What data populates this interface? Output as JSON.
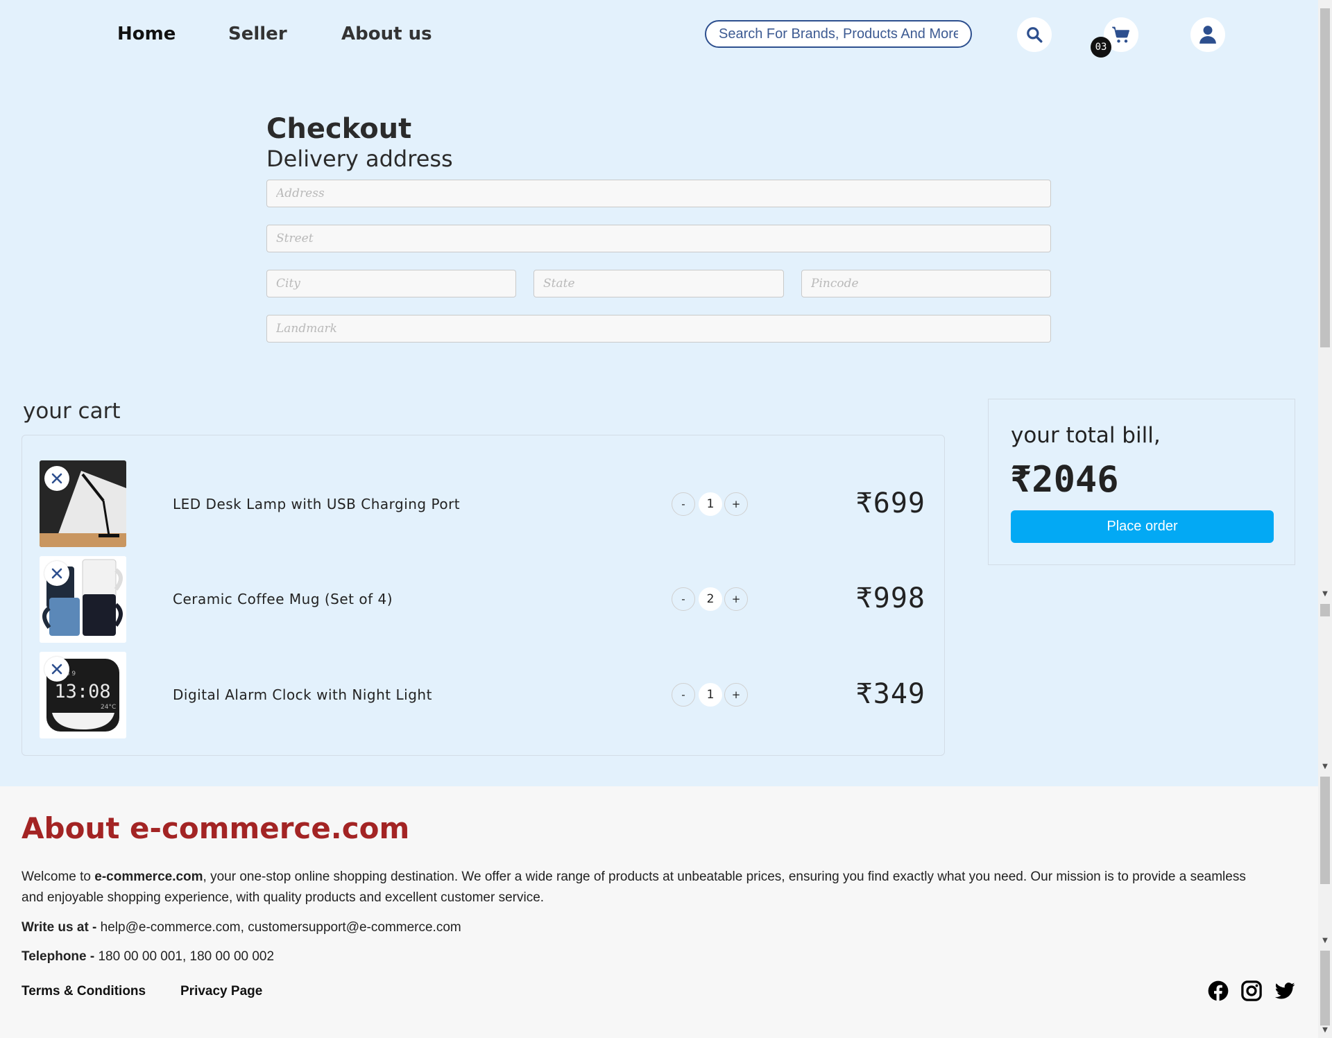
{
  "nav": {
    "links": [
      "Home",
      "Seller",
      "About us"
    ],
    "search_placeholder": "Search For Brands, Products And More",
    "cart_count": "03"
  },
  "checkout": {
    "title": "Checkout",
    "subtitle": "Delivery address",
    "fields": {
      "address": "Address",
      "street": "Street",
      "city": "City",
      "state": "State",
      "pincode": "Pincode",
      "landmark": "Landmark"
    }
  },
  "cart": {
    "title": "your cart",
    "items": [
      {
        "name": "LED Desk Lamp with USB Charging Port",
        "qty": "1",
        "price": "₹699"
      },
      {
        "name": "Ceramic Coffee Mug (Set of 4)",
        "qty": "2",
        "price": "₹998"
      },
      {
        "name": "Digital Alarm Clock with Night Light",
        "qty": "1",
        "price": "₹349"
      }
    ],
    "minus_label": "-",
    "plus_label": "+"
  },
  "bill": {
    "label": "your total bill,",
    "amount": "₹2046",
    "button": "Place order"
  },
  "footer": {
    "title": "About e-commerce.com",
    "intro_before": "Welcome to ",
    "intro_brand": "e-commerce.com",
    "intro_after": ", your one-stop online shopping destination. We offer a wide range of products at unbeatable prices, ensuring you find exactly what you need. Our mission is to provide a seamless and enjoyable shopping experience, with quality products and excellent customer service.",
    "write_label": "Write us at - ",
    "write_value": "help@e-commerce.com, customersupport@e-commerce.com",
    "phone_label": "Telephone - ",
    "phone_value": "180 00 00 001, 180 00 00 002",
    "links": [
      "Terms & Conditions",
      "Privacy Page"
    ]
  },
  "colors": {
    "page_bg": "#e3f1fc",
    "accent_button": "#03a9f4",
    "nav_icon": "#2d4f8e",
    "footer_title": "#a32424"
  },
  "icons": [
    "search-icon",
    "cart-icon",
    "user-icon",
    "close-icon",
    "facebook-icon",
    "instagram-icon",
    "twitter-icon"
  ]
}
